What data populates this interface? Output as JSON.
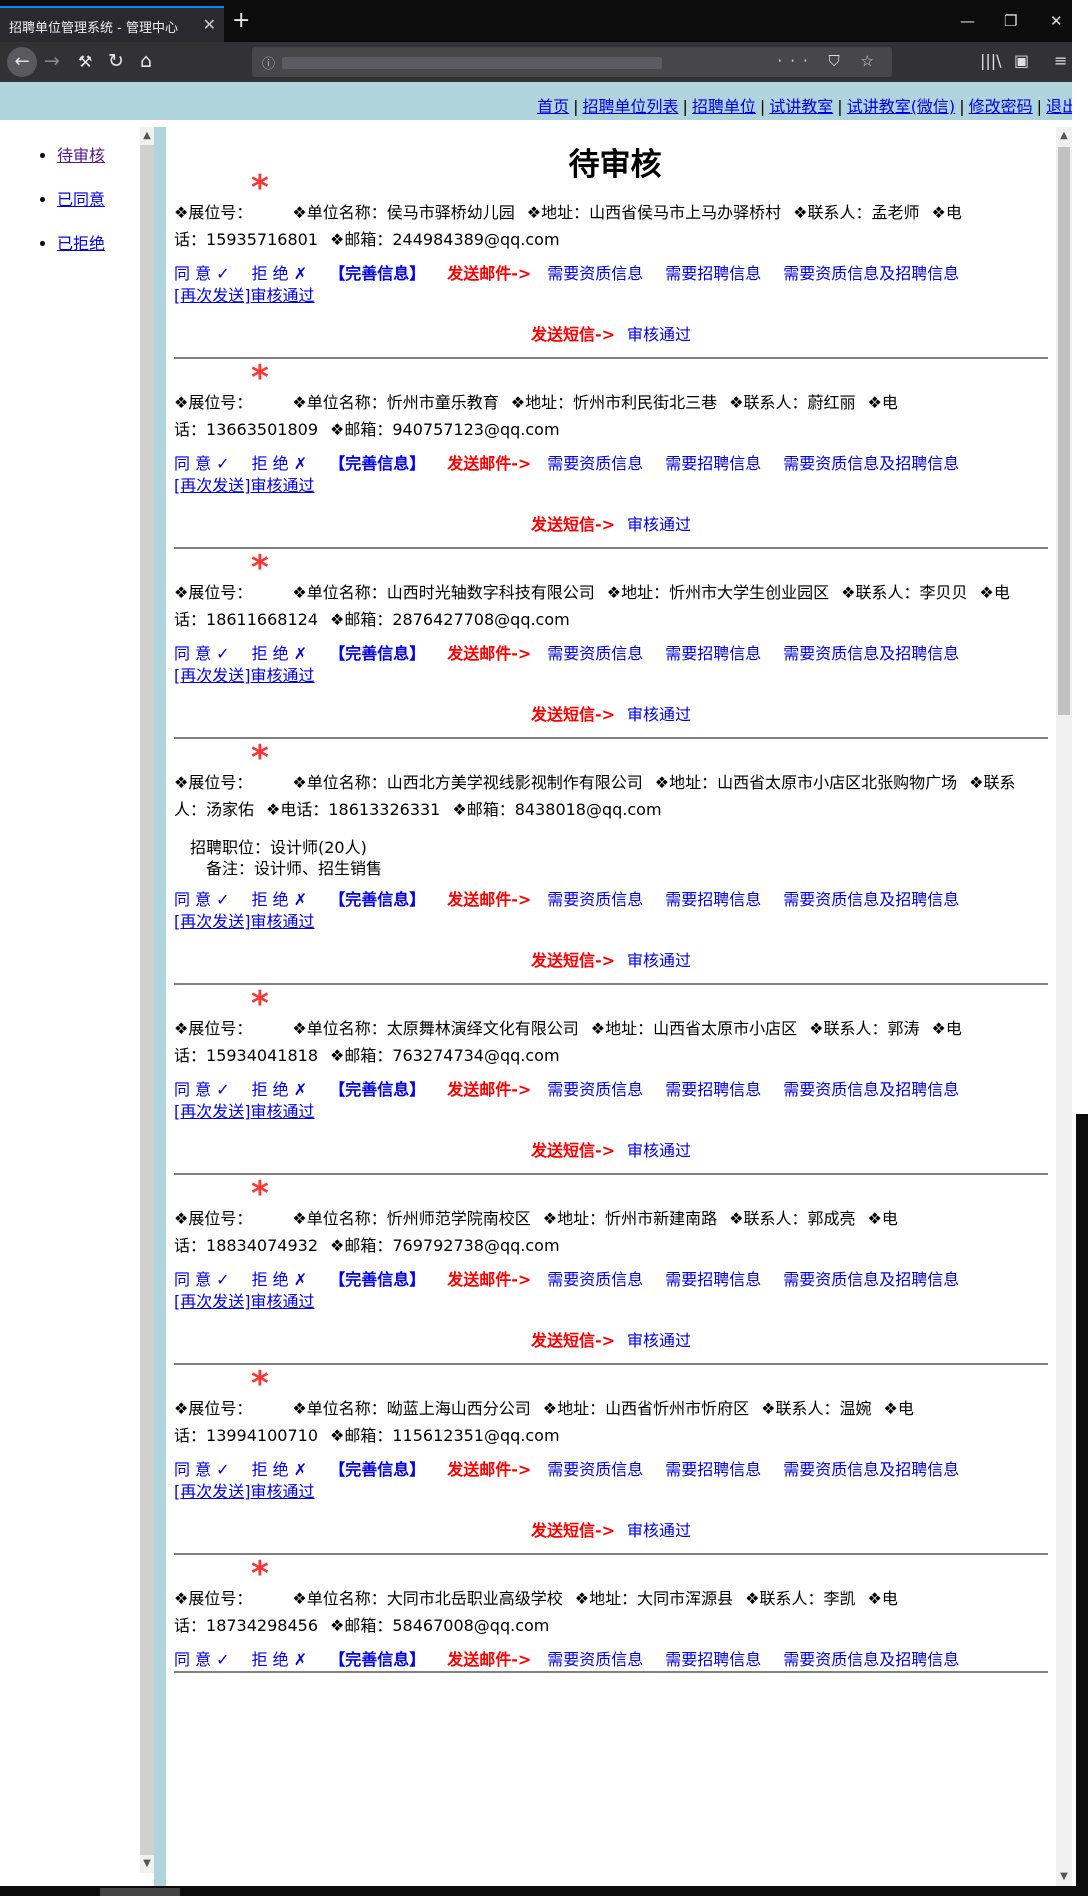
{
  "browser": {
    "tab_title": "招聘单位管理系统 - 管理中心",
    "tab_close": "✕",
    "new_tab": "+",
    "window_controls": [
      "—",
      "❐",
      "✕"
    ],
    "info_icon": "ⓘ",
    "url_icons": "··· ⛉ ☆",
    "toolbar_right": [
      "|||\\",
      "▣",
      "≡"
    ]
  },
  "topnav": {
    "links": [
      "首页",
      "招聘单位列表",
      "招聘单位",
      "试讲教室",
      "试讲教室(微信)",
      "修改密码",
      "退出"
    ],
    "separator": "|"
  },
  "sidebar": {
    "items": [
      "待审核",
      "已同意",
      "已拒绝"
    ]
  },
  "main": {
    "title": "待审核",
    "labels": {
      "booth": "❖展位号：",
      "star": "*",
      "company": "❖单位名称：",
      "address": "❖地址：",
      "contact": "❖联系人：",
      "phone_a": "❖电",
      "phone_b": "话：",
      "phone_full": "❖电话：",
      "email": "❖邮箱："
    },
    "actions": {
      "agree": "同 意 ✓",
      "reject": "拒 绝 ✗",
      "complete": "【完善信息】",
      "send_mail": "发送邮件->",
      "need_qual": "需要资质信息",
      "need_recruit": "需要招聘信息",
      "need_both": "需要资质信息及招聘信息",
      "resend": "[再次发送]审核通过",
      "send_sms": "发送短信->",
      "sms_pass": "审核通过"
    },
    "records": [
      {
        "company": "侯马市驿桥幼儿园",
        "address": "山西省侯马市上马办驿桥村",
        "contact": "孟老师",
        "phone": "15935716801",
        "email": "244984389@qq.com"
      },
      {
        "company": "忻州市童乐教育",
        "address": "忻州市利民街北三巷",
        "contact": "蔚红丽",
        "phone": "13663501809",
        "email": "940757123@qq.com"
      },
      {
        "company": "山西时光轴数字科技有限公司",
        "address": "忻州市大学生创业园区",
        "contact": "李贝贝",
        "phone": "18611668124",
        "email": "2876427708@qq.com"
      },
      {
        "company": "山西北方美学视线影视制作有限公司",
        "address": "山西省太原市小店区北张购物广场",
        "contact_a": "❖联系",
        "contact_b": "人：汤家佑",
        "phone": "18613326331",
        "email": "8438018@qq.com",
        "position": "招聘职位：设计师(20人)",
        "note": "备注：设计师、招生销售"
      },
      {
        "company": "太原舞林演绎文化有限公司",
        "address": "山西省太原市小店区",
        "contact": "郭涛",
        "phone": "15934041818",
        "email": "763274734@qq.com"
      },
      {
        "company": "忻州师范学院南校区",
        "address": "忻州市新建南路",
        "contact": "郭成亮",
        "phone": "18834074932",
        "email": "769792738@qq.com"
      },
      {
        "company": "呦蓝上海山西分公司",
        "address": "山西省忻州市忻府区",
        "contact": "温婉",
        "phone": "13994100710",
        "email": "115612351@qq.com"
      },
      {
        "company": "大同市北岳职业高级学校",
        "address": "大同市浑源县",
        "contact": "李凯",
        "phone": "18734298456",
        "email": "58467008@qq.com"
      }
    ]
  }
}
